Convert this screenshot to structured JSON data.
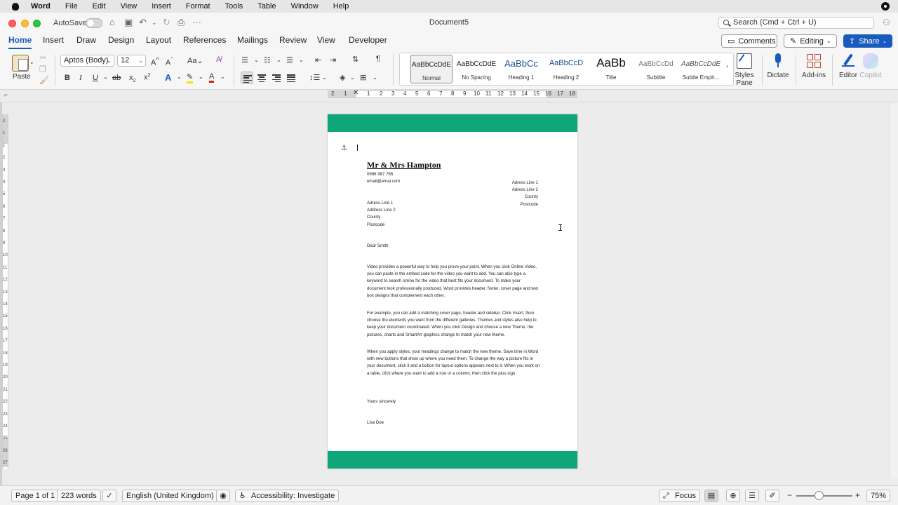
{
  "menubar": {
    "app_name": "Word",
    "items": [
      "File",
      "Edit",
      "View",
      "Insert",
      "Format",
      "Tools",
      "Table",
      "Window",
      "Help"
    ]
  },
  "titlebar": {
    "autosave_label": "AutoSave",
    "document_title": "Document5",
    "search_placeholder": "Search (Cmd + Ctrl + U)"
  },
  "ribbon_tabs": [
    "Home",
    "Insert",
    "Draw",
    "Design",
    "Layout",
    "References",
    "Mailings",
    "Review",
    "View",
    "Developer"
  ],
  "ribbon_buttons": {
    "comments": "Comments",
    "editing": "Editing",
    "share": "Share"
  },
  "ribbon": {
    "paste_label": "Paste",
    "font_name": "Aptos (Body)",
    "font_size": "12",
    "styles": [
      {
        "preview": "AaBbCcDdE",
        "name": "Normal"
      },
      {
        "preview": "AaBbCcDdE",
        "name": "No Spacing"
      },
      {
        "preview": "AaBbCc",
        "name": "Heading 1"
      },
      {
        "preview": "AaBbCcD",
        "name": "Heading 2"
      },
      {
        "preview": "AaBb",
        "name": "Title"
      },
      {
        "preview": "AaBbCcDd",
        "name": "Subtitle"
      },
      {
        "preview": "AaBbCcDdE",
        "name": "Subtle Emph..."
      }
    ],
    "styles_pane_line1": "Styles",
    "styles_pane_line2": "Pane",
    "dictate": "Dictate",
    "addins": "Add-ins",
    "editor": "Editor",
    "copilot": "Copilot"
  },
  "ruler": {
    "h_numbers": [
      "2",
      "1",
      "1",
      "2",
      "3",
      "4",
      "5",
      "6",
      "7",
      "8",
      "9",
      "10",
      "11",
      "12",
      "13",
      "14",
      "15",
      "16",
      "17",
      "18"
    ],
    "v_numbers": [
      "2",
      "1",
      "1",
      "2",
      "3",
      "4",
      "5",
      "6",
      "7",
      "8",
      "9",
      "10",
      "11",
      "12",
      "13",
      "14",
      "15",
      "16",
      "17",
      "18",
      "19",
      "20",
      "21",
      "22",
      "23",
      "24",
      "25",
      "26",
      "27"
    ]
  },
  "document": {
    "band_color": "#0fa67a",
    "sender_name": "Mr & Mrs Hampton",
    "sender_phone": "0986 987 765",
    "sender_email": "email@emai.com",
    "recipient_lines": [
      "Adress Line 1",
      "Adress Line 2",
      "County",
      "Postcode"
    ],
    "sender_address_lines": [
      "Adress Line 1",
      "Address Line 2",
      "County",
      "Postcode"
    ],
    "salutation": "Dear Smith",
    "paragraph1": "Video provides a powerful way to help you prove your point. When you click Online Video, you can paste in the embed code for the video you want to add. You can also type a keyword to search online for the video that best fits your document. To make your document look professionally produced, Word provides header, footer, cover page and text box designs that complement each other.",
    "paragraph2": "For example, you can add a matching cover page, header and sidebar. Click Insert, then choose the elements you want from the different galleries. Themes and styles also help to keep your document coordinated. When you click Design and choose a new Theme, the pictures, charts and SmartArt graphics change to match your new theme.",
    "paragraph3": "When you apply styles, your headings change to match the new theme. Save time in Word with new buttons that show up where you need them. To change the way a picture fits in your document, click it and a button for layout options appears next to it. When you work on a table, click where you want to add a row or a column, then click the plus sign.",
    "closing": "Yours sincerely",
    "signature": "Lisa Doe"
  },
  "statusbar": {
    "page": "Page 1 of 1",
    "words": "223 words",
    "language": "English (United Kingdom)",
    "accessibility": "Accessibility: Investigate",
    "focus": "Focus",
    "zoom": "75%",
    "zoom_level_fraction": 0.4
  }
}
